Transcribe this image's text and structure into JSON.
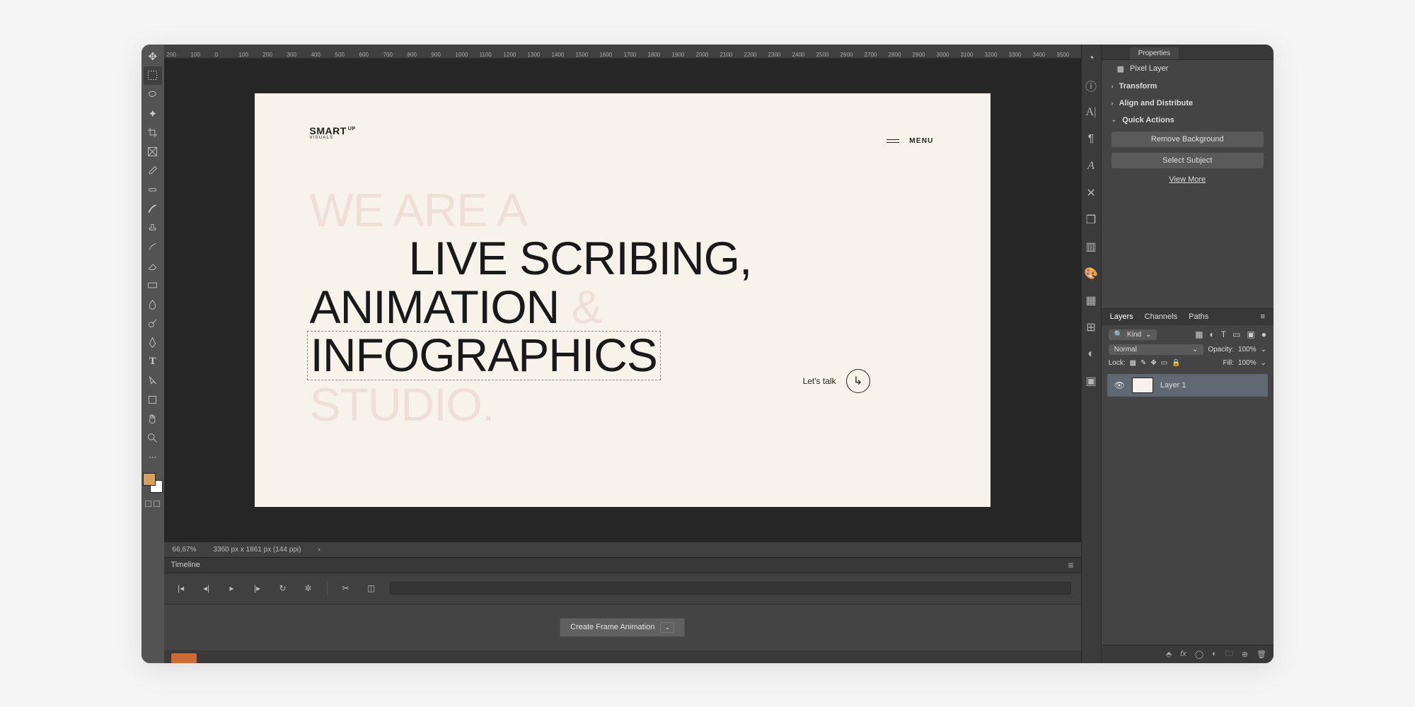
{
  "ruler": [
    "200",
    "100",
    "0",
    "100",
    "200",
    "300",
    "400",
    "500",
    "600",
    "700",
    "800",
    "900",
    "1000",
    "1100",
    "1200",
    "1300",
    "1400",
    "1500",
    "1600",
    "1700",
    "1800",
    "1900",
    "2000",
    "2100",
    "2200",
    "2300",
    "2400",
    "2500",
    "2600",
    "2700",
    "2800",
    "2900",
    "3000",
    "3100",
    "3200",
    "3300",
    "3400",
    "3500"
  ],
  "canvas": {
    "logo_main": "SMART",
    "logo_sup": "UP",
    "logo_sub": "VISUALS",
    "menu_label": "MENU",
    "line1": "WE ARE A",
    "line2": "LIVE SCRIBING,",
    "line3a": "ANIMATION",
    "line3b": "&",
    "line4": "INFOGRAPHICS",
    "line5": "STUDIO.",
    "cta_text": "Let's talk",
    "cta_icon": "↳"
  },
  "status": {
    "zoom": "66,67%",
    "dims": "3360 px x 1861 px (144 ppi)"
  },
  "timeline": {
    "title": "Timeline",
    "create": "Create Frame Animation"
  },
  "props": {
    "tab": "Properties",
    "type": "Pixel Layer",
    "transform": "Transform",
    "align": "Align and Distribute",
    "quick": "Quick Actions",
    "remove_bg": "Remove Background",
    "select_subject": "Select Subject",
    "view_more": "View More"
  },
  "layers": {
    "tab_layers": "Layers",
    "tab_channels": "Channels",
    "tab_paths": "Paths",
    "kind": "Kind",
    "blend": "Normal",
    "opacity_label": "Opacity:",
    "opacity_val": "100%",
    "lock_label": "Lock:",
    "fill_label": "Fill:",
    "fill_val": "100%",
    "layer1": "Layer 1"
  },
  "footer_labels": {
    "fx": "fx"
  }
}
